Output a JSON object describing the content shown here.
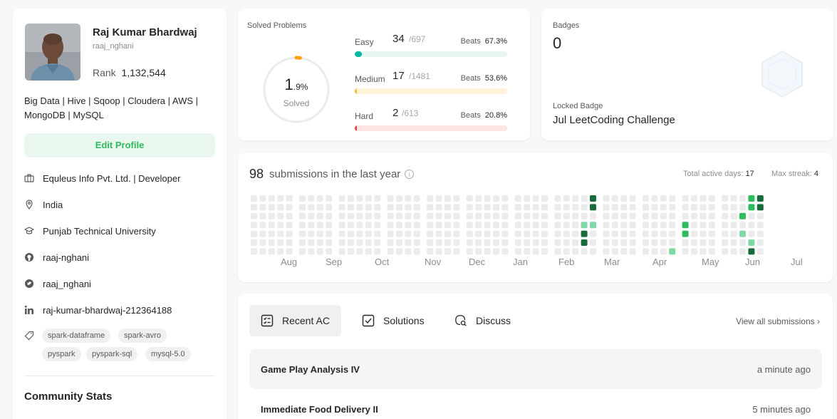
{
  "profile": {
    "name": "Raj Kumar Bhardwaj",
    "username": "raaj_nghani",
    "rank_label": "Rank",
    "rank_value": "1,132,544",
    "bio": "Big Data | Hive | Sqoop | Cloudera | AWS | MongoDB | MySQL",
    "edit_button": "Edit Profile",
    "company": "Equleus Info Pvt. Ltd. | Developer",
    "location": "India",
    "school": "Punjab Technical University",
    "github": "raaj-nghani",
    "twitter": "raaj_nghani",
    "linkedin": "raj-kumar-bhardwaj-212364188",
    "skills": [
      "spark-dataframe",
      "spark-avro",
      "pyspark",
      "pyspark-sql",
      "mysql-5.0"
    ],
    "community_title": "Community Stats"
  },
  "solved": {
    "title": "Solved Problems",
    "percent_main": "1",
    "percent_dec": ".9%",
    "percent_value": 1.9,
    "solved_label": "Solved",
    "beats_label": "Beats",
    "difficulties": [
      {
        "label": "Easy",
        "count": "34",
        "total": "/697",
        "beats": "67.3%",
        "color": "#00b8a3",
        "track": "#e6f6f0",
        "fraction": 0.049
      },
      {
        "label": "Medium",
        "count": "17",
        "total": "/1481",
        "beats": "53.6%",
        "color": "#ffc01e",
        "track": "#fff4d9",
        "fraction": 0.011
      },
      {
        "label": "Hard",
        "count": "2",
        "total": "/613",
        "beats": "20.8%",
        "color": "#ef4743",
        "track": "#fde3e3",
        "fraction": 0.003
      }
    ]
  },
  "badges": {
    "label": "Badges",
    "count": "0",
    "locked_label": "Locked Badge",
    "locked_name": "Jul LeetCoding Challenge"
  },
  "calendar": {
    "count": "98",
    "text": "submissions in the last year",
    "info_icon": "info-icon",
    "active_label": "Total active days:",
    "active_value": "17",
    "streak_label": "Max streak:",
    "streak_value": "4",
    "months": [
      "Aug",
      "Sep",
      "Oct",
      "Nov",
      "Dec",
      "Jan",
      "Feb",
      "Mar",
      "Apr",
      "May",
      "Jun",
      "Jul"
    ],
    "colors": {
      "empty": "#ebebeb",
      "light": "#7fd8a6",
      "mid": "#2cbb5d",
      "dark": "#1a6b3c"
    }
  },
  "recent": {
    "tabs": [
      {
        "label": "Recent AC",
        "icon": "checklist-icon"
      },
      {
        "label": "Solutions",
        "icon": "checkbox-icon"
      },
      {
        "label": "Discuss",
        "icon": "chat-search-icon"
      }
    ],
    "view_all": "View all submissions",
    "items": [
      {
        "title": "Game Play Analysis IV",
        "time": "a minute ago"
      },
      {
        "title": "Immediate Food Delivery II",
        "time": "5 minutes ago"
      }
    ]
  }
}
